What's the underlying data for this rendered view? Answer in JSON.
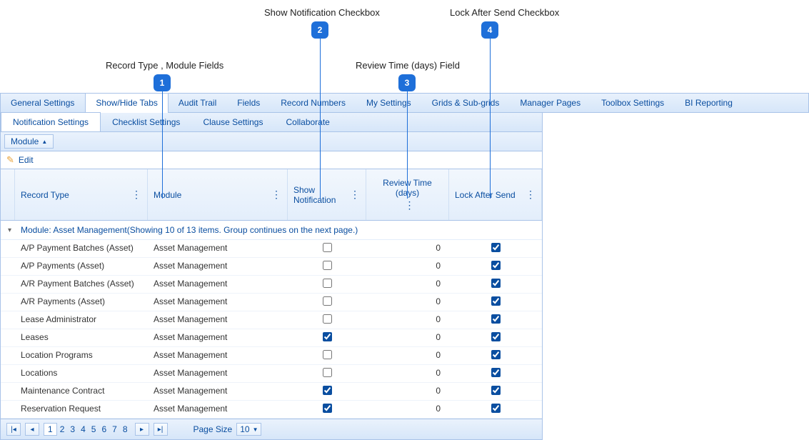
{
  "callouts": {
    "c1": "Record Type , Module Fields",
    "c2": "Show Notification Checkbox",
    "c3": "Review Time (days) Field",
    "c4": "Lock After Send Checkbox",
    "b1": "1",
    "b2": "2",
    "b3": "3",
    "b4": "4"
  },
  "tabs": {
    "main": [
      "General Settings",
      "Show/Hide Tabs",
      "Audit Trail",
      "Fields",
      "Record Numbers",
      "My Settings",
      "Grids & Sub-grids",
      "Manager Pages",
      "Toolbox Settings",
      "BI Reporting"
    ],
    "active_main": 1,
    "sub": [
      "Notification Settings",
      "Checklist Settings",
      "Clause Settings",
      "Collaborate"
    ],
    "active_sub": 0
  },
  "moduleBar": {
    "label": "Module"
  },
  "editBar": {
    "label": "Edit"
  },
  "headers": {
    "recordType": "Record Type",
    "module": "Module",
    "showNotification": "Show Notification",
    "reviewTime": "Review Time (days)",
    "lockAfterSend": "Lock After Send"
  },
  "group": {
    "text": "Module: Asset Management(Showing 10 of 13 items. Group continues on the next page.)"
  },
  "rows": [
    {
      "recordType": "A/P Payment Batches (Asset)",
      "module": "Asset Management",
      "showNotification": false,
      "reviewTime": "0",
      "lockAfterSend": true
    },
    {
      "recordType": "A/P Payments (Asset)",
      "module": "Asset Management",
      "showNotification": false,
      "reviewTime": "0",
      "lockAfterSend": true
    },
    {
      "recordType": "A/R Payment Batches (Asset)",
      "module": "Asset Management",
      "showNotification": false,
      "reviewTime": "0",
      "lockAfterSend": true
    },
    {
      "recordType": "A/R Payments (Asset)",
      "module": "Asset Management",
      "showNotification": false,
      "reviewTime": "0",
      "lockAfterSend": true
    },
    {
      "recordType": "Lease Administrator",
      "module": "Asset Management",
      "showNotification": false,
      "reviewTime": "0",
      "lockAfterSend": true
    },
    {
      "recordType": "Leases",
      "module": "Asset Management",
      "showNotification": true,
      "reviewTime": "0",
      "lockAfterSend": true
    },
    {
      "recordType": "Location Programs",
      "module": "Asset Management",
      "showNotification": false,
      "reviewTime": "0",
      "lockAfterSend": true
    },
    {
      "recordType": "Locations",
      "module": "Asset Management",
      "showNotification": false,
      "reviewTime": "0",
      "lockAfterSend": true
    },
    {
      "recordType": "Maintenance Contract",
      "module": "Asset Management",
      "showNotification": true,
      "reviewTime": "0",
      "lockAfterSend": true
    },
    {
      "recordType": "Reservation Request",
      "module": "Asset Management",
      "showNotification": true,
      "reviewTime": "0",
      "lockAfterSend": true
    }
  ],
  "pager": {
    "pages": [
      "1",
      "2",
      "3",
      "4",
      "5",
      "6",
      "7",
      "8"
    ],
    "active": 0,
    "pageSizeLabel": "Page Size",
    "pageSize": "10"
  }
}
